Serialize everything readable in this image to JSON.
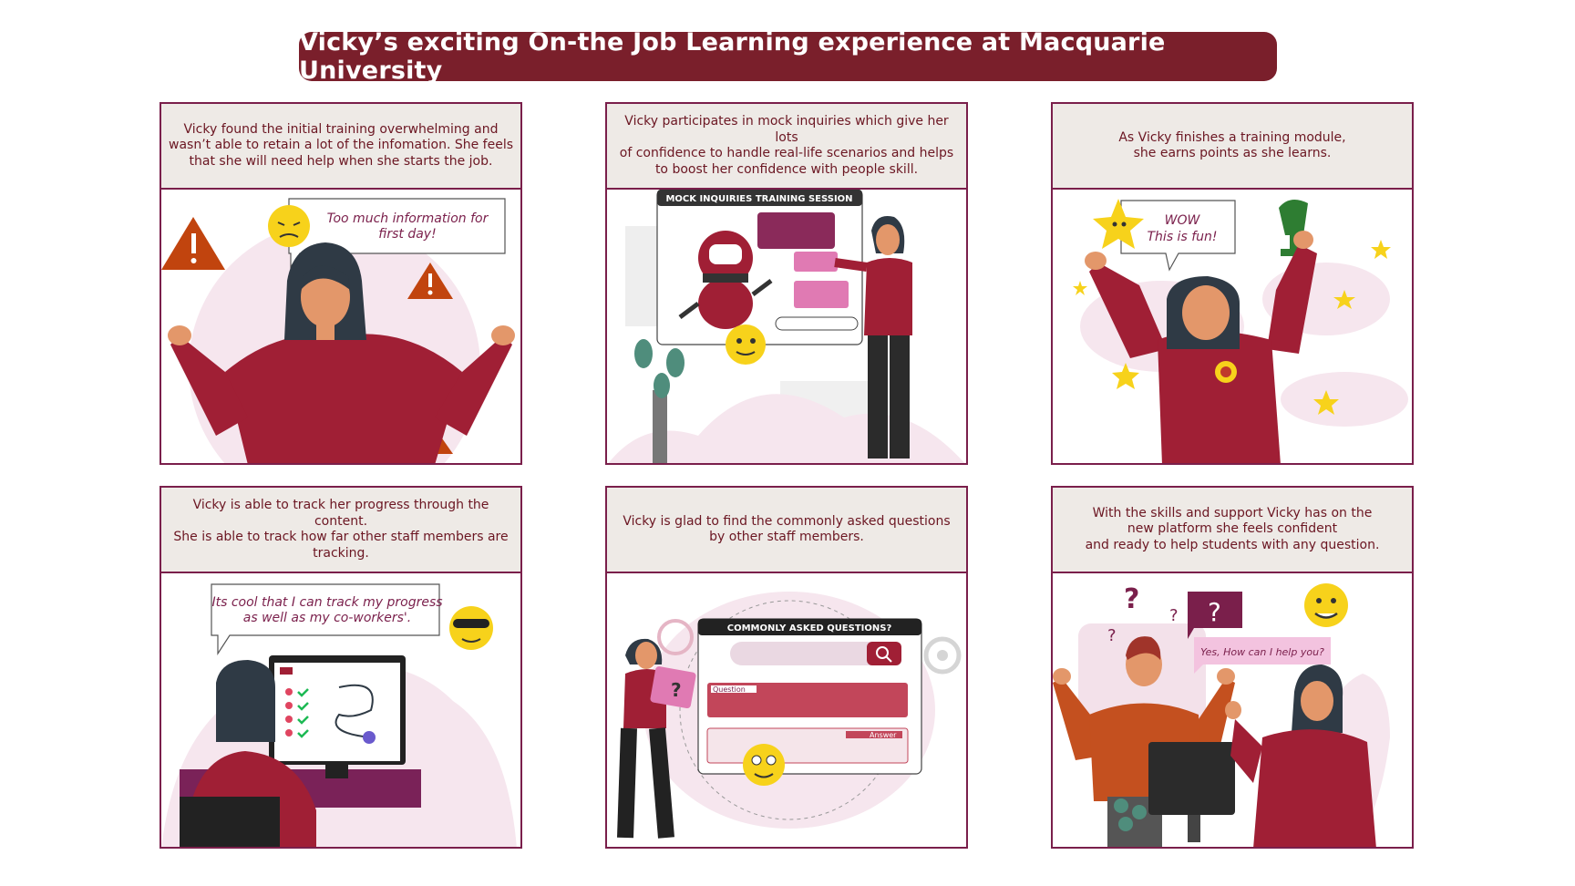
{
  "title": "Vicky’s exciting On-the Job Learning experience at Macquarie University",
  "colors": {
    "maroon": "#7a1f2b",
    "panel_border": "#7a1f4b",
    "caption_bg": "#eeeae6",
    "shirt": "#a01f35"
  },
  "panels": [
    {
      "caption": "Vicky found the initial training overwhelming and\nwasn’t able to retain a lot of the infomation. She feels\nthat she will need help when she starts the job.",
      "bubble_line1": "Too much information for",
      "bubble_line2": "first day!"
    },
    {
      "caption": "Vicky participates in mock inquiries which give her lots\nof confidence to handle real-life scenarios and helps\nto boost her confidence with people skill.",
      "screen_title": "MOCK INQUIRIES TRAINING SESSION"
    },
    {
      "caption": "As Vicky finishes a training module,\nshe earns points as she learns.",
      "bubble_line1": "WOW",
      "bubble_line2": "This is fun!"
    },
    {
      "caption": "Vicky is able to track her progress through the content.\nShe is able to track how far other staff members are\ntracking.",
      "bubble_line1": "Its cool that I can track my progress",
      "bubble_line2": "as well as my co-workers'."
    },
    {
      "caption": "Vicky is glad to find the commonly asked questions\nby other staff members.",
      "screen_title": "COMMONLY ASKED QUESTIONS?",
      "question_label": "Question",
      "answer_label": "Answer"
    },
    {
      "caption": "With the skills and support Vicky has on the\nnew platform she feels confident\nand ready to help students with any question.",
      "bubble_line1": "Yes, How can I help you?"
    }
  ]
}
